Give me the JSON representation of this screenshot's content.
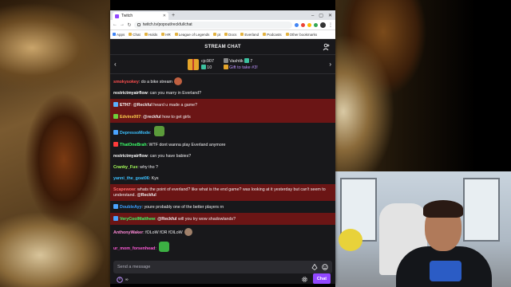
{
  "browser": {
    "tab_title": "Twitch",
    "url": "twitch.tv/popout/reckful/chat",
    "bookmarks": [
      "Apps",
      "Chat",
      "Holds",
      "HR",
      "League of Legends",
      "pt",
      "Docs",
      "Everland",
      "Podcasts",
      "Other bookmarks"
    ]
  },
  "chat": {
    "header": "STREAM CHAT",
    "gifts": {
      "left_user": "cjc907",
      "left_count": "10",
      "right_user": "Vashtik",
      "right_count": "7",
      "right_cta": "Gift to take #3!"
    },
    "messages": [
      {
        "user": "smokysokey",
        "color": "#ff4f4f",
        "text": "do a bike stream",
        "highlight": false,
        "emote": "#c06040"
      },
      {
        "user": "restrictmyairflow",
        "color": "#ffffff",
        "text": "can you marry in Everland?",
        "highlight": false
      },
      {
        "user": "ETH7",
        "color": "#ffffff",
        "text": "@Reckful heard u made a game?",
        "highlight": true,
        "badge": "#5ab0ff",
        "mention": "@Reckful",
        "rest": " heard u made a game?"
      },
      {
        "user": "Edvins007",
        "color": "#ffd24f",
        "text": "@reckful how to get girls",
        "highlight": true,
        "badge": "#6fcf3a",
        "mention": "@reckful",
        "rest": " how to get girls"
      },
      {
        "user": "DepressoMode",
        "color": "#3cc1ff",
        "text": "",
        "highlight": false,
        "badge": "#4aa3ff",
        "emote": "#5b9b3a"
      },
      {
        "user": "ThatOneBrah",
        "color": "#3cff6a",
        "text": "WTF  dont wanna play Everland anymore",
        "highlight": false,
        "badge": "#ff3b3b"
      },
      {
        "user": "restrictmyairflow",
        "color": "#ffffff",
        "text": "can you have babies?",
        "highlight": false
      },
      {
        "user": "Cranky_Fux",
        "color": "#a6ff5a",
        "text": "why tho ?",
        "highlight": false
      },
      {
        "user": "yanni_the_goat06",
        "color": "#3cc1ff",
        "text": "Kys",
        "highlight": false
      },
      {
        "user": "Scapewow",
        "color": "#ff6b6b",
        "text": "whats the point of everland? like what is the end game? was looking at it yesterday but can't seem to understand.",
        "highlight": true,
        "mention": "@Reckful"
      },
      {
        "user": "DoubleAyy",
        "color": "#3ca0ff",
        "text": "youre probably one of the better players rn",
        "highlight": false,
        "badge": "#4aa3ff"
      },
      {
        "user": "VeryCoolMatthew",
        "color": "#3cff6a",
        "text": "@Reckful will you try wow shadowlands?",
        "highlight": true,
        "badge": "#4aa3ff",
        "mention": "@Reckful",
        "rest": " will you try wow shadowlands?"
      },
      {
        "user": "AnthonyWaker",
        "color": "#ff8ad8",
        "text": "fOLoW fOR fOlLoW",
        "highlight": false,
        "emote": "#a0806a"
      },
      {
        "user": "ur_mom_forsenhead",
        "color": "#ff5ad8",
        "text": "",
        "highlight": false,
        "emote": "#3cb043"
      }
    ],
    "input_placeholder": "Send a message",
    "points_value": "∞",
    "chat_button": "Chat"
  },
  "colors": {
    "twitch_purple": "#9147ff",
    "highlight_bg": "#6b1515",
    "chat_bg": "#18181b"
  }
}
